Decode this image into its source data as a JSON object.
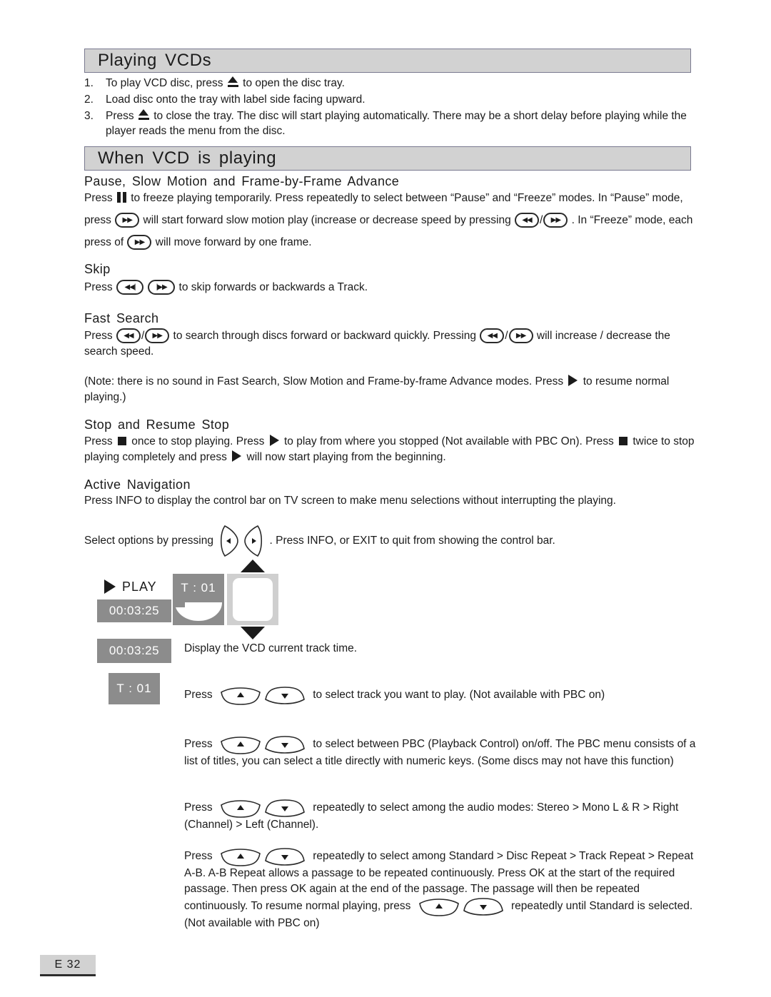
{
  "sections": {
    "playing_vcds": {
      "title": "Playing VCDs",
      "steps": [
        {
          "num": "1.",
          "before": "To play VCD disc, press ",
          "icon": "eject-icon",
          "after": " to open the disc tray."
        },
        {
          "num": "2.",
          "before": "Load disc onto the tray with label side facing upward.",
          "icon": "",
          "after": ""
        },
        {
          "num": "3.",
          "before": "Press ",
          "icon": "eject-icon",
          "after": " to close the tray. The disc will start playing automatically.  There may be a short delay before playing while the player reads the menu from the disc."
        }
      ]
    },
    "when_vcd_playing": {
      "title": "When VCD is playing"
    }
  },
  "pause_slow_motion": {
    "heading": "Pause, Slow Motion and Frame-by-Frame Advance",
    "line1_a": "Press ",
    "line1_b": " to freeze playing temporarily.  Press repeatedly to select between “Pause” and “Freeze” modes. In",
    "line2_a": "“Pause” mode, press ",
    "line2_b": " will start forward slow motion play (increase or decrease speed by pressing",
    "line3_a": " . In “Freeze” mode, each press of ",
    "line3_b": " will move forward by one frame."
  },
  "skip": {
    "heading": "Skip",
    "text_a": "Press ",
    "text_b": " to skip forwards or backwards a Track."
  },
  "fast_search": {
    "heading": "Fast Search",
    "text_a": "Press ",
    "text_b": " to search through discs forward or backward quickly.  Pressing ",
    "text_c": " will increase /",
    "text_d": "decrease the search speed."
  },
  "note": {
    "text_a": "(Note: there is no sound in Fast Search, Slow Motion and Frame-by-frame Advance modes.  Press ",
    "text_b": " to",
    "text_c": "resume normal playing.)"
  },
  "stop_resume": {
    "heading": "Stop and Resume Stop",
    "line1_a": "Press ",
    "line1_b": " once to stop playing. Press ",
    "line1_c": " to play from where you stopped (Not available with PBC On).",
    "line2_a": "Press ",
    "line2_b": " twice to stop playing completely and press ",
    "line2_c": " will now start playing from the beginning."
  },
  "active_navigation": {
    "heading": "Active Navigation",
    "line1": "Press INFO to display the control bar on TV screen to make menu selections without interrupting the playing.",
    "line2_a": "Select options by pressing ",
    "line2_b": " .  Press  INFO, or EXIT to quit from showing the control bar."
  },
  "control_bar": {
    "play_label": "PLAY",
    "time_value": "00:03:25",
    "track_value": "T : 01",
    "play_icon": "play-triangle-icon",
    "disc_icon": "disc-tray-icon",
    "up_icon": "arrow-up-icon",
    "down_icon": "arrow-down-icon"
  },
  "legend": [
    {
      "badge": "00:03:25",
      "badge_type": "time",
      "text_a": "Display the VCD current track time.",
      "text_b": "",
      "text_c": "",
      "has_rocker": false
    },
    {
      "badge": "T : 01",
      "badge_type": "track",
      "text_a": "Press ",
      "text_b": " to select track you want to play. (Not available with PBC on)",
      "text_c": "",
      "has_rocker": true
    }
  ],
  "legend_extra": [
    {
      "text_a": "Press ",
      "text_b": " to select between PBC (Playback Control) on/off. The PBC menu consists",
      "text_c": "of a list of titles, you can select a title directly with numeric keys. (Some discs may not have",
      "text_d": "this function)"
    },
    {
      "text_a": "Press ",
      "text_b": " repeatedly to select among the audio modes: Stereo > Mono L & R",
      "text_c": "> Right (Channel) > Left (Channel).",
      "text_d": ""
    }
  ],
  "repeat_block": {
    "text_a": "Press ",
    "text_b": " repeatedly to select among Standard > Disc Repeat > Track Repeat",
    "text_c": "> Repeat A-B.  A-B Repeat allows a passage to be repeated continuously. Press OK at the",
    "text_d": "start of the required passage. Then press OK again at the end of the passage. The passage",
    "text_e": "will then be repeated continuously. To resume normal playing, press ",
    "text_f": " repeatedly",
    "text_g": "until Standard is selected. (Not available with PBC on)"
  },
  "footer": {
    "page_label": "E 32"
  },
  "icons": {
    "prev_track": "◀◀|",
    "next_track": "|▶▶",
    "rewind": "◀◀",
    "forward": "▶▶"
  },
  "colors": {
    "header_bar": "#d2d2d2",
    "header_border": "#7a7a90",
    "badge_gray": "#8c8c8c",
    "slot_gray": "#cfcfcf",
    "text": "#1b1b1b"
  }
}
